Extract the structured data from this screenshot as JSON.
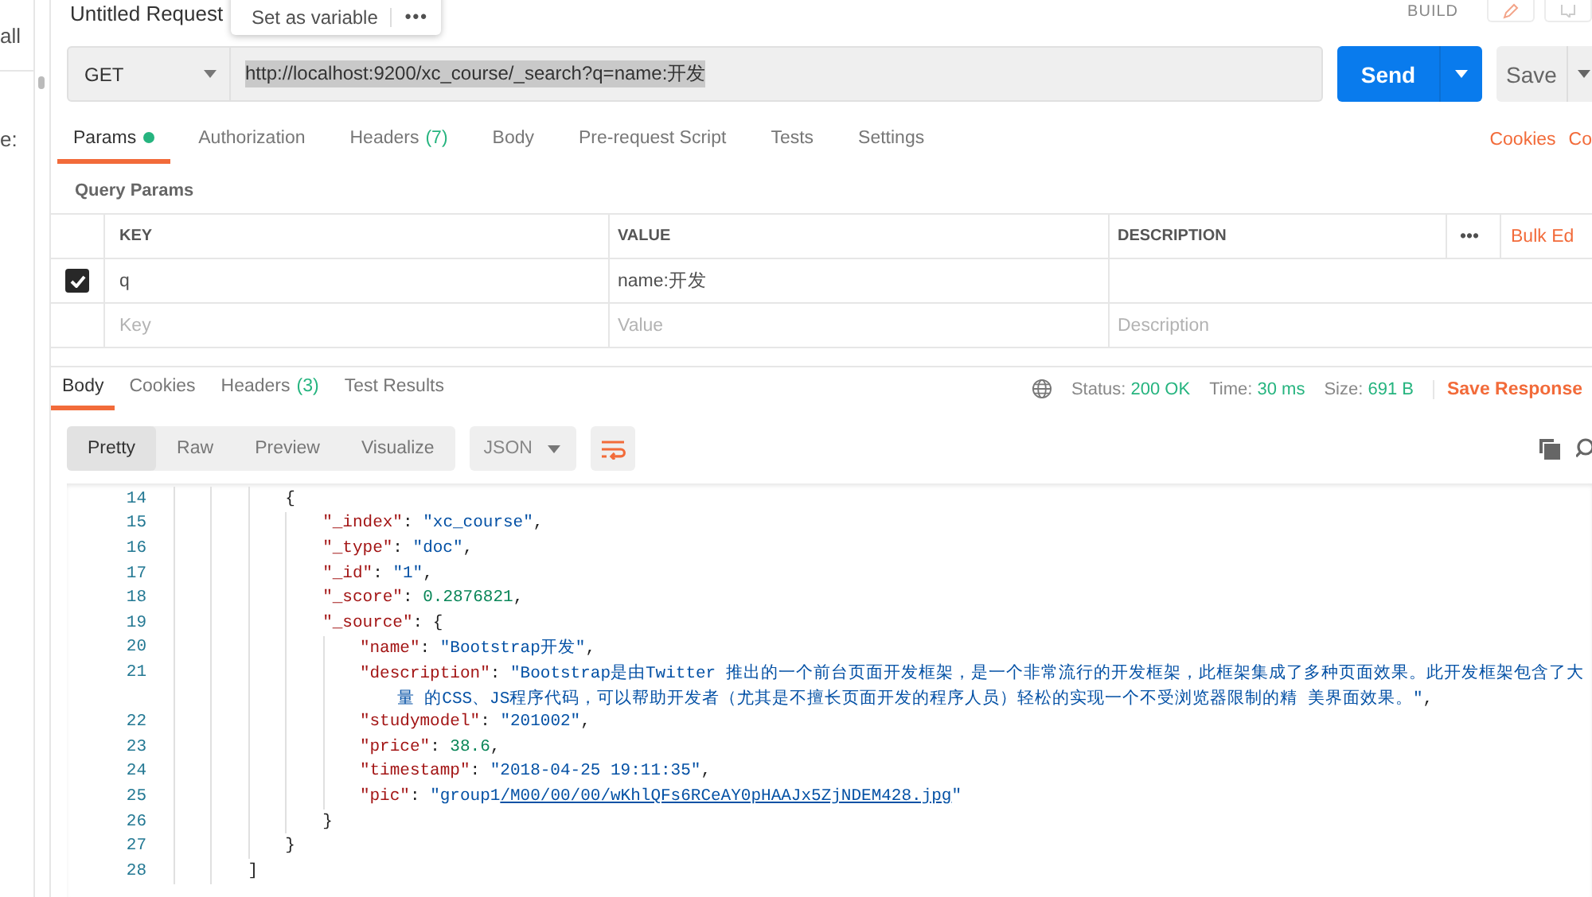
{
  "sidebar": {
    "texts": [
      "all",
      "e:"
    ]
  },
  "request": {
    "title": "Untitled Request",
    "popover": {
      "action": "Set as variable",
      "more": "•••"
    },
    "mode": "BUILD",
    "method": "GET",
    "url": "http://localhost:9200/xc_course/_search?q=name:开发",
    "url_selected": true,
    "send": "Send",
    "save": "Save"
  },
  "request_tabs": [
    {
      "label": "Params",
      "dot": true,
      "selected": true
    },
    {
      "label": "Authorization",
      "dot": false,
      "selected": false
    },
    {
      "label": "Headers",
      "count": "(7)",
      "dot": false,
      "selected": false
    },
    {
      "label": "Body",
      "dot": false,
      "selected": false
    },
    {
      "label": "Pre-request Script",
      "dot": false,
      "selected": false
    },
    {
      "label": "Tests",
      "dot": false,
      "selected": false
    },
    {
      "label": "Settings",
      "dot": false,
      "selected": false
    }
  ],
  "request_links": [
    "Cookies",
    "Co"
  ],
  "query_params": {
    "title": "Query Params",
    "columns": [
      "KEY",
      "VALUE",
      "DESCRIPTION"
    ],
    "more": "•••",
    "bulk_edit": "Bulk Ed",
    "rows": [
      {
        "checked": true,
        "key": "q",
        "value": "name:开发"
      }
    ],
    "new_row": {
      "key_placeholder": "Key",
      "value_placeholder": "Value",
      "description_placeholder": "Description"
    }
  },
  "response": {
    "tabs": [
      {
        "label": "Body",
        "selected": true
      },
      {
        "label": "Cookies",
        "selected": false
      },
      {
        "label": "Headers",
        "count": "(3)",
        "selected": false
      },
      {
        "label": "Test Results",
        "selected": false
      }
    ],
    "status": [
      {
        "label": "Status:",
        "value": "200 OK"
      },
      {
        "label": "Time:",
        "value": "30 ms"
      },
      {
        "label": "Size:",
        "value": "691 B"
      }
    ],
    "save": "Save Response",
    "views": [
      {
        "label": "Pretty",
        "selected": true
      },
      {
        "label": "Raw",
        "selected": false
      },
      {
        "label": "Preview",
        "selected": false
      },
      {
        "label": "Visualize",
        "selected": false
      }
    ],
    "format": "JSON",
    "wrap_lines": true
  },
  "code": [
    {
      "children": [
        {
          "number": "14",
          "tokens": [
            {
              "kind": "punct",
              "text": "{"
            }
          ],
          "children": [
            {
              "number": "15",
              "tokens": [
                {
                  "kind": "key",
                  "text": "\"_index\""
                },
                {
                  "kind": "punct",
                  "text": ": "
                },
                {
                  "kind": "string",
                  "text": "\"xc_course\""
                },
                {
                  "kind": "punct",
                  "text": ","
                }
              ]
            },
            {
              "number": "16",
              "tokens": [
                {
                  "kind": "key",
                  "text": "\"_type\""
                },
                {
                  "kind": "punct",
                  "text": ": "
                },
                {
                  "kind": "string",
                  "text": "\"doc\""
                },
                {
                  "kind": "punct",
                  "text": ","
                }
              ]
            },
            {
              "number": "17",
              "tokens": [
                {
                  "kind": "key",
                  "text": "\"_id\""
                },
                {
                  "kind": "punct",
                  "text": ": "
                },
                {
                  "kind": "string",
                  "text": "\"1\""
                },
                {
                  "kind": "punct",
                  "text": ","
                }
              ]
            },
            {
              "number": "18",
              "tokens": [
                {
                  "kind": "key",
                  "text": "\"_score\""
                },
                {
                  "kind": "punct",
                  "text": ": "
                },
                {
                  "kind": "number",
                  "text": "0.2876821"
                },
                {
                  "kind": "punct",
                  "text": ","
                }
              ]
            },
            {
              "number": "19",
              "tokens": [
                {
                  "kind": "key",
                  "text": "\"_source\""
                },
                {
                  "kind": "punct",
                  "text": ": {"
                }
              ],
              "children": [
                {
                  "number": "20",
                  "tokens": [
                    {
                      "kind": "key",
                      "text": "\"name\""
                    },
                    {
                      "kind": "punct",
                      "text": ": "
                    },
                    {
                      "kind": "string",
                      "text": "\"Bootstrap开发\""
                    },
                    {
                      "kind": "punct",
                      "text": ","
                    }
                  ]
                },
                {
                  "number": "21",
                  "tokens": [
                    {
                      "kind": "key",
                      "text": "\"description\""
                    },
                    {
                      "kind": "punct",
                      "text": ": "
                    },
                    {
                      "kind": "string",
                      "text": "\"Bootstrap是由Twitter 推出的一个前台页面开发框架，是一个非常流行的开发框架，此框架集成了多种页面效果。此开发框架包含了大"
                    }
                  ],
                  "wrap": [
                    {
                      "kind": "string",
                      "text": "量 的CSS、JS程序代码，可以帮助开发者（尤其是不擅长页面开发的程序人员）轻松的实现一个不受浏览器限制的精 美界面效果。\""
                    },
                    {
                      "kind": "punct",
                      "text": ","
                    }
                  ]
                },
                {
                  "number": "22",
                  "tokens": [
                    {
                      "kind": "key",
                      "text": "\"studymodel\""
                    },
                    {
                      "kind": "punct",
                      "text": ": "
                    },
                    {
                      "kind": "string",
                      "text": "\"201002\""
                    },
                    {
                      "kind": "punct",
                      "text": ","
                    }
                  ]
                },
                {
                  "number": "23",
                  "tokens": [
                    {
                      "kind": "key",
                      "text": "\"price\""
                    },
                    {
                      "kind": "punct",
                      "text": ": "
                    },
                    {
                      "kind": "number",
                      "text": "38.6"
                    },
                    {
                      "kind": "punct",
                      "text": ","
                    }
                  ]
                },
                {
                  "number": "24",
                  "tokens": [
                    {
                      "kind": "key",
                      "text": "\"timestamp\""
                    },
                    {
                      "kind": "punct",
                      "text": ": "
                    },
                    {
                      "kind": "string",
                      "text": "\"2018-04-25 19:11:35\""
                    },
                    {
                      "kind": "punct",
                      "text": ","
                    }
                  ]
                },
                {
                  "number": "25",
                  "tokens": [
                    {
                      "kind": "key",
                      "text": "\"pic\""
                    },
                    {
                      "kind": "punct",
                      "text": ": "
                    },
                    {
                      "kind": "string",
                      "text": "\"group1"
                    },
                    {
                      "kind": "link",
                      "text": "/M00/00/00/wKhlQFs6RCeAY0pHAAJx5ZjNDEM428.jpg"
                    },
                    {
                      "kind": "string",
                      "text": "\""
                    }
                  ]
                }
              ]
            },
            {
              "number": "26",
              "tokens": [
                {
                  "kind": "punct",
                  "text": "}"
                }
              ]
            }
          ]
        },
        {
          "number": "27",
          "tokens": [
            {
              "kind": "punct",
              "text": "}"
            }
          ]
        }
      ]
    },
    {
      "number": "28",
      "tokens": [
        {
          "kind": "punct",
          "text": "]"
        }
      ]
    }
  ]
}
